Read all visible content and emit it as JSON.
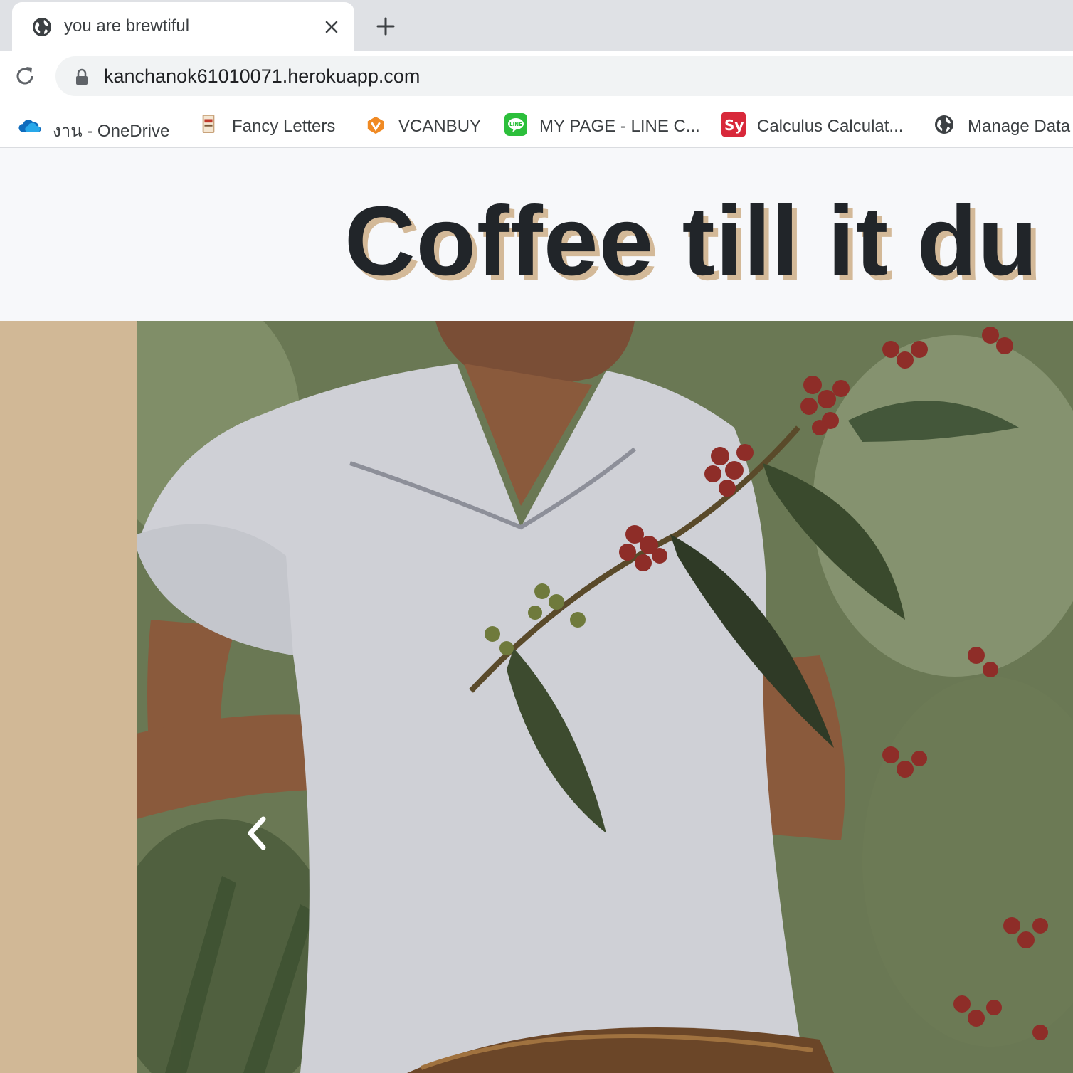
{
  "browser": {
    "tab": {
      "title": "you are brewtiful",
      "icon": "globe-icon"
    },
    "new_tab_icon": "plus-icon",
    "toolbar": {
      "reload_icon": "reload-icon",
      "url": "kanchanok61010071.herokuapp.com",
      "secure_icon": "lock-icon"
    },
    "bookmarks": [
      {
        "label": "งาน - OneDrive",
        "icon": "onedrive-cloud-icon"
      },
      {
        "label": "Fancy Letters",
        "icon": "fancy-letters-icon"
      },
      {
        "label": "VCANBUY",
        "icon": "vcanbuy-icon"
      },
      {
        "label": "MY PAGE - LINE C...",
        "icon": "line-icon"
      },
      {
        "label": "Calculus Calculat...",
        "icon": "symbolab-sy-icon",
        "icon_text": "Sy"
      },
      {
        "label": "Manage Data",
        "icon": "globe-icon"
      }
    ]
  },
  "page": {
    "hero_title": "Coffee till it du",
    "colors": {
      "title_text": "#212529",
      "title_shadow": "#d3b998",
      "side_band": "#d1b896",
      "header_bg": "#f7f8fa"
    },
    "carousel": {
      "image_description_icon": "coffee-picker-photo",
      "prev_icon": "chevron-left-icon"
    }
  }
}
